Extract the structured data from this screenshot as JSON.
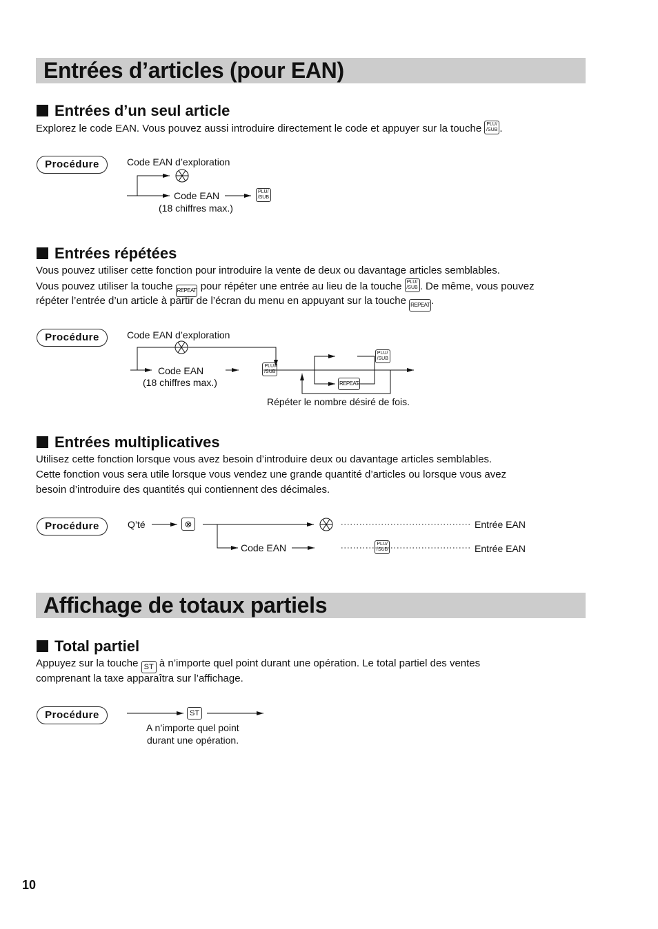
{
  "sections": [
    {
      "title": "Entrées d’articles (pour EAN)",
      "subsections": [
        {
          "heading": "Entrées d’un seul article",
          "text": {
            "before_key": "Explorez le code EAN. Vous pouvez aussi introduire directement le code et appuyer sur la touche",
            "after_key": "."
          },
          "diagram": {
            "procedure_label": "Procédure",
            "scan_label": "Code EAN d’exploration",
            "code_label": "Code EAN",
            "digits_label": "(18 chiffres max.)"
          }
        },
        {
          "heading": "Entrées répétées",
          "lines": [
            "Vous pouvez utiliser cette fonction pour introduire la vente de deux ou davantage articles semblables.",
            {
              "a": "Vous pouvez utiliser la touche",
              "b": "pour répéter une entrée au lieu de la touche",
              "c": ". De même, vous pouvez"
            },
            {
              "a": "répéter l’entrée d’un article à partir de l’écran du menu en appuyant sur la touche",
              "b": "."
            }
          ],
          "diagram": {
            "procedure_label": "Procédure",
            "scan_label": "Code EAN d’exploration",
            "code_label": "Code EAN",
            "digits_label": "(18 chiffres max.)",
            "repeat_note": "Répéter le nombre désiré de fois."
          }
        },
        {
          "heading": "Entrées multiplicatives",
          "lines": [
            "Utilisez cette fonction lorsque vous avez besoin d’introduire deux ou davantage articles semblables.",
            "Cette fonction vous sera utile lorsque vous vendez une grande quantité d’articles ou lorsque vous avez",
            "besoin d’introduire des quantités qui contiennent des décimales."
          ],
          "diagram": {
            "procedure_label": "Procédure",
            "qty_label": "Q’té",
            "code_label": "Code EAN",
            "result1": "Entrée EAN",
            "result2": "Entrée EAN"
          }
        }
      ]
    },
    {
      "title": "Affichage de totaux partiels",
      "subsections": [
        {
          "heading": "Total partiel",
          "lines": [
            {
              "a": "Appuyez sur la touche",
              "b": "à n’importe quel point durant une opération. Le total partiel des ventes"
            },
            "comprenant la taxe apparaîtra sur l’affichage."
          ],
          "diagram": {
            "procedure_label": "Procédure",
            "note_line1": "A n’importe quel point",
            "note_line2": "durant une opération."
          }
        }
      ]
    }
  ],
  "keys": {
    "plu_top": "PLU/",
    "plu_bottom": "/SUB",
    "repeat": "REPEAT",
    "st": "ST",
    "multiply_icon": "multiply-key-icon",
    "scan_icon": "scanner-icon"
  },
  "page_number": "10"
}
